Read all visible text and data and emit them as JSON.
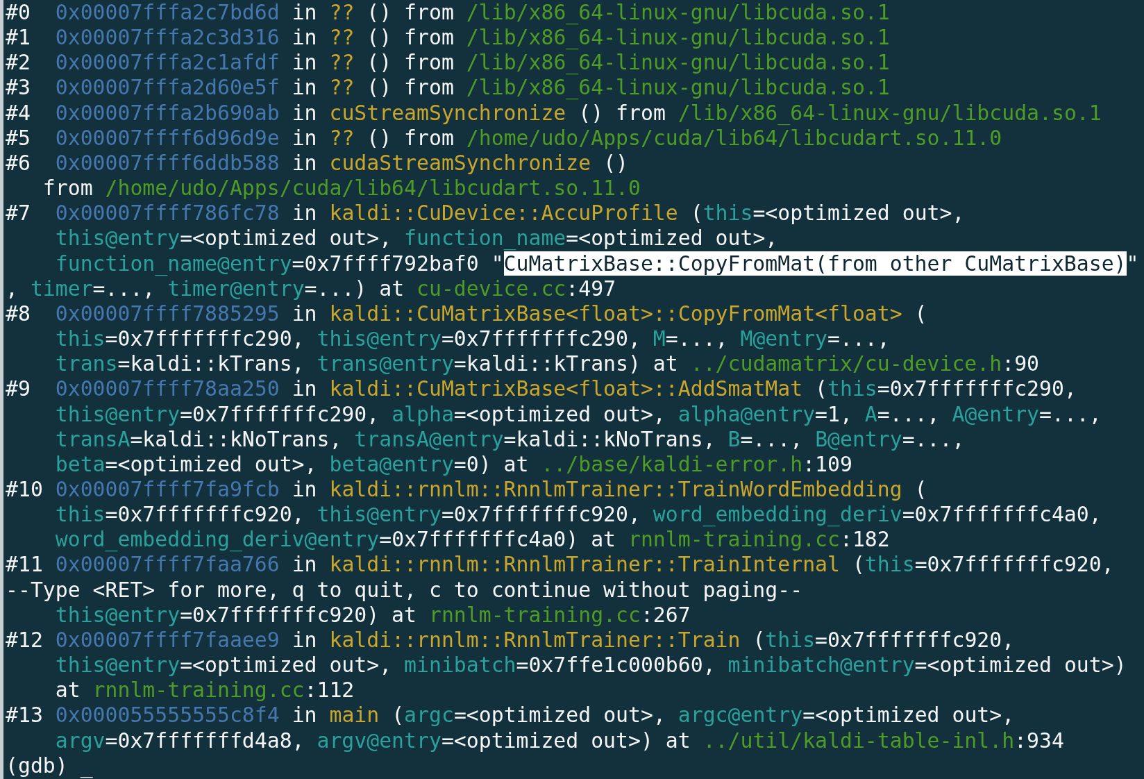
{
  "terminal": {
    "lines": [
      {
        "segments": [
          {
            "kind": "plain",
            "text": "#0  "
          },
          {
            "kind": "address",
            "text": "0x00007fffa2c7bd6d"
          },
          {
            "kind": "plain",
            "text": " in "
          },
          {
            "kind": "function",
            "text": "??"
          },
          {
            "kind": "plain",
            "text": " () from "
          },
          {
            "kind": "path",
            "text": "/lib/x86_64-linux-gnu/libcuda.so.1"
          }
        ]
      },
      {
        "segments": [
          {
            "kind": "plain",
            "text": "#1  "
          },
          {
            "kind": "address",
            "text": "0x00007fffa2c3d316"
          },
          {
            "kind": "plain",
            "text": " in "
          },
          {
            "kind": "function",
            "text": "??"
          },
          {
            "kind": "plain",
            "text": " () from "
          },
          {
            "kind": "path",
            "text": "/lib/x86_64-linux-gnu/libcuda.so.1"
          }
        ]
      },
      {
        "segments": [
          {
            "kind": "plain",
            "text": "#2  "
          },
          {
            "kind": "address",
            "text": "0x00007fffa2c1afdf"
          },
          {
            "kind": "plain",
            "text": " in "
          },
          {
            "kind": "function",
            "text": "??"
          },
          {
            "kind": "plain",
            "text": " () from "
          },
          {
            "kind": "path",
            "text": "/lib/x86_64-linux-gnu/libcuda.so.1"
          }
        ]
      },
      {
        "segments": [
          {
            "kind": "plain",
            "text": "#3  "
          },
          {
            "kind": "address",
            "text": "0x00007fffa2d60e5f"
          },
          {
            "kind": "plain",
            "text": " in "
          },
          {
            "kind": "function",
            "text": "??"
          },
          {
            "kind": "plain",
            "text": " () from "
          },
          {
            "kind": "path",
            "text": "/lib/x86_64-linux-gnu/libcuda.so.1"
          }
        ]
      },
      {
        "segments": [
          {
            "kind": "plain",
            "text": "#4  "
          },
          {
            "kind": "address",
            "text": "0x00007fffa2b690ab"
          },
          {
            "kind": "plain",
            "text": " in "
          },
          {
            "kind": "function",
            "text": "cuStreamSynchronize"
          },
          {
            "kind": "plain",
            "text": " () from "
          },
          {
            "kind": "path",
            "text": "/lib/x86_64-linux-gnu/libcuda.so.1"
          }
        ]
      },
      {
        "segments": [
          {
            "kind": "plain",
            "text": "#5  "
          },
          {
            "kind": "address",
            "text": "0x00007ffff6d96d9e"
          },
          {
            "kind": "plain",
            "text": " in "
          },
          {
            "kind": "function",
            "text": "??"
          },
          {
            "kind": "plain",
            "text": " () from "
          },
          {
            "kind": "path",
            "text": "/home/udo/Apps/cuda/lib64/libcudart.so.11.0"
          }
        ]
      },
      {
        "segments": [
          {
            "kind": "plain",
            "text": "#6  "
          },
          {
            "kind": "address",
            "text": "0x00007ffff6ddb588"
          },
          {
            "kind": "plain",
            "text": " in "
          },
          {
            "kind": "function",
            "text": "cudaStreamSynchronize"
          },
          {
            "kind": "plain",
            "text": " ()"
          }
        ]
      },
      {
        "segments": [
          {
            "kind": "plain",
            "text": "   from "
          },
          {
            "kind": "path",
            "text": "/home/udo/Apps/cuda/lib64/libcudart.so.11.0"
          }
        ]
      },
      {
        "segments": [
          {
            "kind": "plain",
            "text": "#7  "
          },
          {
            "kind": "address",
            "text": "0x00007ffff786fc78"
          },
          {
            "kind": "plain",
            "text": " in "
          },
          {
            "kind": "function",
            "text": "kaldi::CuDevice::AccuProfile"
          },
          {
            "kind": "plain",
            "text": " ("
          },
          {
            "kind": "parameter",
            "text": "this"
          },
          {
            "kind": "plain",
            "text": "=<optimized out>,"
          }
        ]
      },
      {
        "segments": [
          {
            "kind": "parameter",
            "text": "    this@entry"
          },
          {
            "kind": "plain",
            "text": "=<optimized out>, "
          },
          {
            "kind": "parameter",
            "text": "function_name"
          },
          {
            "kind": "plain",
            "text": "=<optimized out>,"
          }
        ]
      },
      {
        "segments": [
          {
            "kind": "parameter",
            "text": "    function_name@entry"
          },
          {
            "kind": "plain",
            "text": "=0x7ffff792baf0 \""
          },
          {
            "kind": "selection",
            "text": "CuMatrixBase::CopyFromMat(from other CuMatrixBase)"
          },
          {
            "kind": "plain",
            "text": "\""
          }
        ]
      },
      {
        "segments": [
          {
            "kind": "plain",
            "text": ", "
          },
          {
            "kind": "parameter",
            "text": "timer"
          },
          {
            "kind": "plain",
            "text": "=..., "
          },
          {
            "kind": "parameter",
            "text": "timer@entry"
          },
          {
            "kind": "plain",
            "text": "=...) at "
          },
          {
            "kind": "path",
            "text": "cu-device.cc"
          },
          {
            "kind": "plain",
            "text": ":497"
          }
        ]
      },
      {
        "segments": [
          {
            "kind": "plain",
            "text": "#8  "
          },
          {
            "kind": "address",
            "text": "0x00007ffff7885295"
          },
          {
            "kind": "plain",
            "text": " in "
          },
          {
            "kind": "function",
            "text": "kaldi::CuMatrixBase<float>::CopyFromMat<float>"
          },
          {
            "kind": "plain",
            "text": " ("
          }
        ]
      },
      {
        "segments": [
          {
            "kind": "parameter",
            "text": "    this"
          },
          {
            "kind": "plain",
            "text": "=0x7fffffffc290, "
          },
          {
            "kind": "parameter",
            "text": "this@entry"
          },
          {
            "kind": "plain",
            "text": "=0x7fffffffc290, "
          },
          {
            "kind": "parameter",
            "text": "M"
          },
          {
            "kind": "plain",
            "text": "=..., "
          },
          {
            "kind": "parameter",
            "text": "M@entry"
          },
          {
            "kind": "plain",
            "text": "=...,"
          }
        ]
      },
      {
        "segments": [
          {
            "kind": "parameter",
            "text": "    trans"
          },
          {
            "kind": "plain",
            "text": "=kaldi::kTrans, "
          },
          {
            "kind": "parameter",
            "text": "trans@entry"
          },
          {
            "kind": "plain",
            "text": "=kaldi::kTrans) at "
          },
          {
            "kind": "path",
            "text": "../cudamatrix/cu-device.h"
          },
          {
            "kind": "plain",
            "text": ":90"
          }
        ]
      },
      {
        "segments": [
          {
            "kind": "plain",
            "text": "#9  "
          },
          {
            "kind": "address",
            "text": "0x00007ffff78aa250"
          },
          {
            "kind": "plain",
            "text": " in "
          },
          {
            "kind": "function",
            "text": "kaldi::CuMatrixBase<float>::AddSmatMat"
          },
          {
            "kind": "plain",
            "text": " ("
          },
          {
            "kind": "parameter",
            "text": "this"
          },
          {
            "kind": "plain",
            "text": "=0x7fffffffc290,"
          }
        ]
      },
      {
        "segments": [
          {
            "kind": "parameter",
            "text": "    this@entry"
          },
          {
            "kind": "plain",
            "text": "=0x7fffffffc290, "
          },
          {
            "kind": "parameter",
            "text": "alpha"
          },
          {
            "kind": "plain",
            "text": "=<optimized out>, "
          },
          {
            "kind": "parameter",
            "text": "alpha@entry"
          },
          {
            "kind": "plain",
            "text": "=1, "
          },
          {
            "kind": "parameter",
            "text": "A"
          },
          {
            "kind": "plain",
            "text": "=..., "
          },
          {
            "kind": "parameter",
            "text": "A@entry"
          },
          {
            "kind": "plain",
            "text": "=...,"
          }
        ]
      },
      {
        "segments": [
          {
            "kind": "parameter",
            "text": "    transA"
          },
          {
            "kind": "plain",
            "text": "=kaldi::kNoTrans, "
          },
          {
            "kind": "parameter",
            "text": "transA@entry"
          },
          {
            "kind": "plain",
            "text": "=kaldi::kNoTrans, "
          },
          {
            "kind": "parameter",
            "text": "B"
          },
          {
            "kind": "plain",
            "text": "=..., "
          },
          {
            "kind": "parameter",
            "text": "B@entry"
          },
          {
            "kind": "plain",
            "text": "=...,"
          }
        ]
      },
      {
        "segments": [
          {
            "kind": "parameter",
            "text": "    beta"
          },
          {
            "kind": "plain",
            "text": "=<optimized out>, "
          },
          {
            "kind": "parameter",
            "text": "beta@entry"
          },
          {
            "kind": "plain",
            "text": "=0) at "
          },
          {
            "kind": "path",
            "text": "../base/kaldi-error.h"
          },
          {
            "kind": "plain",
            "text": ":109"
          }
        ]
      },
      {
        "segments": [
          {
            "kind": "plain",
            "text": "#10 "
          },
          {
            "kind": "address",
            "text": "0x00007ffff7fa9fcb"
          },
          {
            "kind": "plain",
            "text": " in "
          },
          {
            "kind": "function",
            "text": "kaldi::rnnlm::RnnlmTrainer::TrainWordEmbedding"
          },
          {
            "kind": "plain",
            "text": " ("
          }
        ]
      },
      {
        "segments": [
          {
            "kind": "parameter",
            "text": "    this"
          },
          {
            "kind": "plain",
            "text": "=0x7fffffffc920, "
          },
          {
            "kind": "parameter",
            "text": "this@entry"
          },
          {
            "kind": "plain",
            "text": "=0x7fffffffc920, "
          },
          {
            "kind": "parameter",
            "text": "word_embedding_deriv"
          },
          {
            "kind": "plain",
            "text": "=0x7fffffffc4a0,"
          }
        ]
      },
      {
        "segments": [
          {
            "kind": "parameter",
            "text": "    word_embedding_deriv@entry"
          },
          {
            "kind": "plain",
            "text": "=0x7fffffffc4a0) at "
          },
          {
            "kind": "path",
            "text": "rnnlm-training.cc"
          },
          {
            "kind": "plain",
            "text": ":182"
          }
        ]
      },
      {
        "segments": [
          {
            "kind": "plain",
            "text": "#11 "
          },
          {
            "kind": "address",
            "text": "0x00007ffff7faa766"
          },
          {
            "kind": "plain",
            "text": " in "
          },
          {
            "kind": "function",
            "text": "kaldi::rnnlm::RnnlmTrainer::TrainInternal"
          },
          {
            "kind": "plain",
            "text": " ("
          },
          {
            "kind": "parameter",
            "text": "this"
          },
          {
            "kind": "plain",
            "text": "=0x7fffffffc920,"
          }
        ]
      },
      {
        "segments": [
          {
            "kind": "plain",
            "text": "--Type <RET> for more, q to quit, c to continue without paging--"
          }
        ]
      },
      {
        "segments": [
          {
            "kind": "parameter",
            "text": "    this@entry"
          },
          {
            "kind": "plain",
            "text": "=0x7fffffffc920) at "
          },
          {
            "kind": "path",
            "text": "rnnlm-training.cc"
          },
          {
            "kind": "plain",
            "text": ":267"
          }
        ]
      },
      {
        "segments": [
          {
            "kind": "plain",
            "text": "#12 "
          },
          {
            "kind": "address",
            "text": "0x00007ffff7faaee9"
          },
          {
            "kind": "plain",
            "text": " in "
          },
          {
            "kind": "function",
            "text": "kaldi::rnnlm::RnnlmTrainer::Train"
          },
          {
            "kind": "plain",
            "text": " ("
          },
          {
            "kind": "parameter",
            "text": "this"
          },
          {
            "kind": "plain",
            "text": "=0x7fffffffc920,"
          }
        ]
      },
      {
        "segments": [
          {
            "kind": "parameter",
            "text": "    this@entry"
          },
          {
            "kind": "plain",
            "text": "=<optimized out>, "
          },
          {
            "kind": "parameter",
            "text": "minibatch"
          },
          {
            "kind": "plain",
            "text": "=0x7ffe1c000b60, "
          },
          {
            "kind": "parameter",
            "text": "minibatch@entry"
          },
          {
            "kind": "plain",
            "text": "=<optimized out>)"
          }
        ]
      },
      {
        "segments": [
          {
            "kind": "plain",
            "text": "    at "
          },
          {
            "kind": "path",
            "text": "rnnlm-training.cc"
          },
          {
            "kind": "plain",
            "text": ":112"
          }
        ]
      },
      {
        "segments": [
          {
            "kind": "plain",
            "text": "#13 "
          },
          {
            "kind": "address",
            "text": "0x000055555555c8f4"
          },
          {
            "kind": "plain",
            "text": " in "
          },
          {
            "kind": "function",
            "text": "main"
          },
          {
            "kind": "plain",
            "text": " ("
          },
          {
            "kind": "parameter",
            "text": "argc"
          },
          {
            "kind": "plain",
            "text": "=<optimized out>, "
          },
          {
            "kind": "parameter",
            "text": "argc@entry"
          },
          {
            "kind": "plain",
            "text": "=<optimized out>,"
          }
        ]
      },
      {
        "segments": [
          {
            "kind": "parameter",
            "text": "    argv"
          },
          {
            "kind": "plain",
            "text": "=0x7fffffffd4a8, "
          },
          {
            "kind": "parameter",
            "text": "argv@entry"
          },
          {
            "kind": "plain",
            "text": "=<optimized out>) at "
          },
          {
            "kind": "path",
            "text": "../util/kaldi-table-inl.h"
          },
          {
            "kind": "plain",
            "text": ":934"
          }
        ]
      },
      {
        "segments": [
          {
            "kind": "plain",
            "text": "(gdb) "
          },
          {
            "kind": "cursor",
            "text": "_"
          }
        ]
      }
    ]
  }
}
